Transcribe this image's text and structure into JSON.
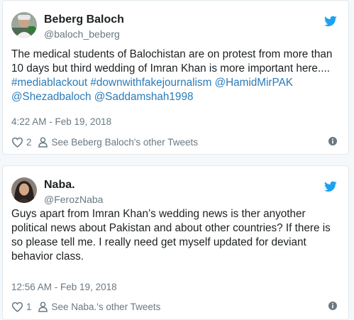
{
  "tweets": [
    {
      "name": "Beberg Baloch",
      "handle": "@baloch_beberg",
      "text_plain": "The medical students of Balochistan are on protest from more than 10 days but third wedding of Imran Khan is more important here.... ",
      "hashtag1": "#mediablackout",
      "hashtag2": "#downwithfakejournalism",
      "mention1": "@HamidMirPAK",
      "mention2": "@Shezadbaloch",
      "mention3": "@Saddamshah1998",
      "time": "4:22 AM - Feb 19, 2018",
      "likes": "2",
      "other_tweets": "See Beberg Baloch's other Tweets"
    },
    {
      "name": "Naba.",
      "handle": "@FerozNaba",
      "text_plain": "Guys apart from Imran Khan’s wedding news is ther anyother political news about Pakistan and about other countries? If there is so please tell me. I really need get myself updated for deviant behavior class.",
      "time": "12:56 AM - Feb 19, 2018",
      "likes": "1",
      "other_tweets": "See Naba.'s other Tweets"
    }
  ],
  "colors": {
    "link": "#2b7bb9",
    "twitter_blue": "#1da1f2",
    "text": "#1c2022",
    "muted": "#697882"
  },
  "icons": {
    "brand": "twitter-bird-icon",
    "like": "heart-icon",
    "profile": "person-icon",
    "info": "info-icon"
  }
}
